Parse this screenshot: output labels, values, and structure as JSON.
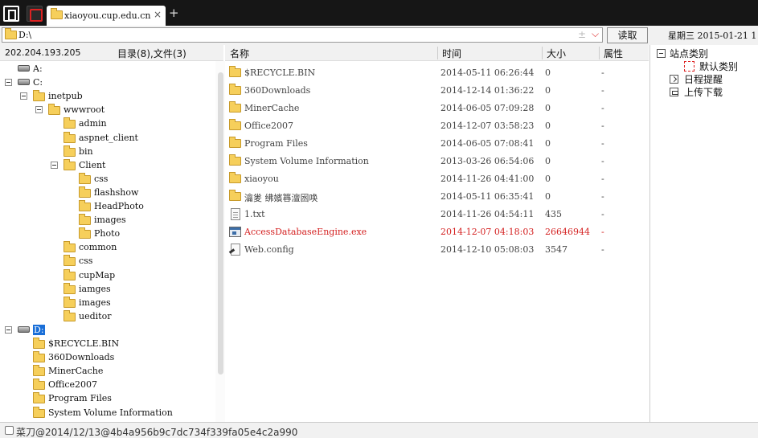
{
  "tabbar": {
    "tab_title": "xiaoyou.cup.edu.cn",
    "close_glyph": "×",
    "new_tab_glyph": "+"
  },
  "address": {
    "path": "D:\\",
    "plus_glyph": "±",
    "dropdown_glyph": "⌵",
    "read_button": "读取",
    "date": "星期三  2015-01-21  1"
  },
  "left_header": {
    "ip": "202.204.193.205",
    "counts": "目录(8),文件(3)"
  },
  "tree": [
    {
      "label": "A:",
      "depth": 0,
      "type": "drive",
      "toggle": false,
      "selected": false
    },
    {
      "label": "C:",
      "depth": 0,
      "type": "drive",
      "toggle": true,
      "selected": false
    },
    {
      "label": "inetpub",
      "depth": 1,
      "type": "folder",
      "toggle": true,
      "selected": false
    },
    {
      "label": "wwwroot",
      "depth": 2,
      "type": "folder",
      "toggle": true,
      "selected": false
    },
    {
      "label": "admin",
      "depth": 3,
      "type": "folder",
      "toggle": false,
      "selected": false
    },
    {
      "label": "aspnet_client",
      "depth": 3,
      "type": "folder",
      "toggle": false,
      "selected": false
    },
    {
      "label": "bin",
      "depth": 3,
      "type": "folder",
      "toggle": false,
      "selected": false
    },
    {
      "label": "Client",
      "depth": 3,
      "type": "folder",
      "toggle": true,
      "selected": false
    },
    {
      "label": "css",
      "depth": 4,
      "type": "folder",
      "toggle": false,
      "selected": false
    },
    {
      "label": "flashshow",
      "depth": 4,
      "type": "folder",
      "toggle": false,
      "selected": false
    },
    {
      "label": "HeadPhoto",
      "depth": 4,
      "type": "folder",
      "toggle": false,
      "selected": false
    },
    {
      "label": "images",
      "depth": 4,
      "type": "folder",
      "toggle": false,
      "selected": false
    },
    {
      "label": "Photo",
      "depth": 4,
      "type": "folder",
      "toggle": false,
      "selected": false
    },
    {
      "label": "common",
      "depth": 3,
      "type": "folder",
      "toggle": false,
      "selected": false
    },
    {
      "label": "css",
      "depth": 3,
      "type": "folder",
      "toggle": false,
      "selected": false
    },
    {
      "label": "cupMap",
      "depth": 3,
      "type": "folder",
      "toggle": false,
      "selected": false
    },
    {
      "label": "iamges",
      "depth": 3,
      "type": "folder",
      "toggle": false,
      "selected": false
    },
    {
      "label": "images",
      "depth": 3,
      "type": "folder",
      "toggle": false,
      "selected": false
    },
    {
      "label": "ueditor",
      "depth": 3,
      "type": "folder",
      "toggle": false,
      "selected": false
    },
    {
      "label": "D:",
      "depth": 0,
      "type": "drive",
      "toggle": true,
      "selected": true
    },
    {
      "label": "$RECYCLE.BIN",
      "depth": 1,
      "type": "folder",
      "toggle": false,
      "selected": false
    },
    {
      "label": "360Downloads",
      "depth": 1,
      "type": "folder",
      "toggle": false,
      "selected": false
    },
    {
      "label": "MinerCache",
      "depth": 1,
      "type": "folder",
      "toggle": false,
      "selected": false
    },
    {
      "label": "Office2007",
      "depth": 1,
      "type": "folder",
      "toggle": false,
      "selected": false
    },
    {
      "label": "Program Files",
      "depth": 1,
      "type": "folder",
      "toggle": false,
      "selected": false
    },
    {
      "label": "System Volume Information",
      "depth": 1,
      "type": "folder",
      "toggle": false,
      "selected": false
    }
  ],
  "columns": {
    "name": "名称",
    "time": "时间",
    "size": "大小",
    "attr": "属性"
  },
  "files": [
    {
      "name": "$RECYCLE.BIN",
      "time": "2014-05-11 06:26:44",
      "size": "0",
      "attr": "-",
      "kind": "folder",
      "highlight": false
    },
    {
      "name": "360Downloads",
      "time": "2014-12-14 01:36:22",
      "size": "0",
      "attr": "-",
      "kind": "folder",
      "highlight": false
    },
    {
      "name": "MinerCache",
      "time": "2014-06-05 07:09:28",
      "size": "0",
      "attr": "-",
      "kind": "folder",
      "highlight": false
    },
    {
      "name": "Office2007",
      "time": "2014-12-07 03:58:23",
      "size": "0",
      "attr": "-",
      "kind": "folder",
      "highlight": false
    },
    {
      "name": "Program Files",
      "time": "2014-06-05 07:08:41",
      "size": "0",
      "attr": "-",
      "kind": "folder",
      "highlight": false
    },
    {
      "name": "System Volume Information",
      "time": "2013-03-26 06:54:06",
      "size": "0",
      "attr": "-",
      "kind": "folder",
      "highlight": false
    },
    {
      "name": "xiaoyou",
      "time": "2014-11-26 04:41:00",
      "size": "0",
      "attr": "-",
      "kind": "folder",
      "highlight": false
    },
    {
      "name": "瀹夎   绋嬪簭澶囦唤",
      "time": "2014-05-11 06:35:41",
      "size": "0",
      "attr": "-",
      "kind": "folder",
      "highlight": false
    },
    {
      "name": "1.txt",
      "time": "2014-11-26 04:54:11",
      "size": "435",
      "attr": "-",
      "kind": "txt",
      "highlight": false
    },
    {
      "name": "AccessDatabaseEngine.exe",
      "time": "2014-12-07 04:18:03",
      "size": "26646944",
      "attr": "-",
      "kind": "exe",
      "highlight": true
    },
    {
      "name": "Web.config",
      "time": "2014-12-10 05:08:03",
      "size": "3547",
      "attr": "-",
      "kind": "config",
      "highlight": false
    }
  ],
  "sidebar": {
    "site_category": "站点类别",
    "default_category": "默认类别",
    "schedule_reminder": "日程提醒",
    "upload_download": "上传下载"
  },
  "status": {
    "text": "菜刀@2014/12/13@4b4a956b9c7dc734f339fa05e4c2a990"
  },
  "colors": {
    "highlight_red": "#d42020",
    "selection_blue": "#1a6fd8",
    "topbar_dark": "#161616"
  }
}
